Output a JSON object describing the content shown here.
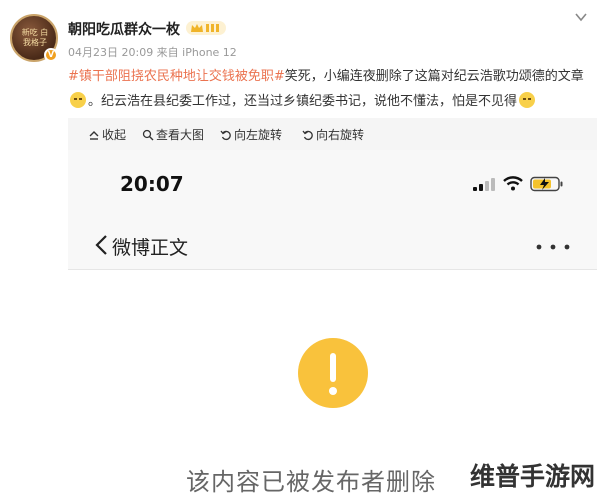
{
  "user": {
    "name": "朝阳吃瓜群众一枚",
    "meta": "04月23日 20:09  来自 iPhone 12",
    "avatar_text": "新吃 白我格子",
    "verified_badge": "V",
    "crown_icon": "crown-badge-icon"
  },
  "post": {
    "hashtag": "#镇干部阻挠农民种地让交钱被免职#",
    "text1": "笑死，小编连夜删除了这篇对纪云浩歌功颂德的文章",
    "text2": "。纪云浩在县纪委工作过，还当过乡镇纪委书记，说他不懂法，怕是不见得"
  },
  "toolbar": {
    "collapse": "收起",
    "view_large": "查看大图",
    "rotate_left": "向左旋转",
    "rotate_right": "向右旋转"
  },
  "phone": {
    "time": "20:07",
    "nav_title": "微博正文"
  },
  "deleted_message": "该内容已被发布者删除",
  "watermark": "维普手游网",
  "colors": {
    "hashtag": "#eb7350",
    "alert": "#f9c23c",
    "crown": "#f0b429"
  }
}
